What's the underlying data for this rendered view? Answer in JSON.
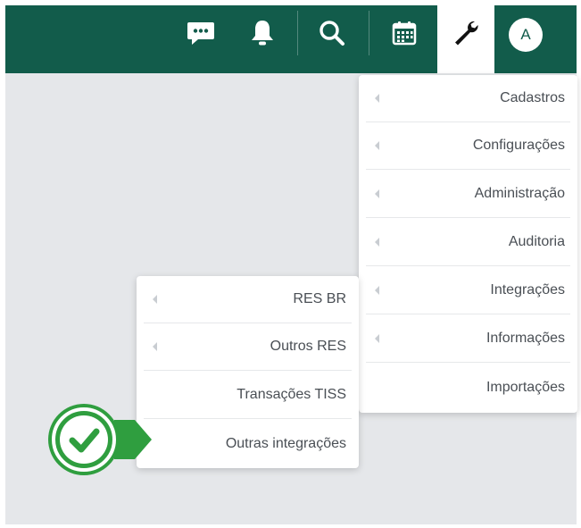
{
  "header": {
    "icons": [
      "chat-icon",
      "bell-icon",
      "search-icon",
      "calendar-icon",
      "wrench-icon"
    ],
    "avatar_letter": "A"
  },
  "main_menu": {
    "items": [
      {
        "label": "Cadastros",
        "has_submenu": true
      },
      {
        "label": "Configurações",
        "has_submenu": true
      },
      {
        "label": "Administração",
        "has_submenu": true
      },
      {
        "label": "Auditoria",
        "has_submenu": true
      },
      {
        "label": "Integrações",
        "has_submenu": true
      },
      {
        "label": "Informações",
        "has_submenu": true
      },
      {
        "label": "Importações",
        "has_submenu": false
      }
    ]
  },
  "sub_menu": {
    "items": [
      {
        "label": "RES BR",
        "has_submenu": true
      },
      {
        "label": "Outros RES",
        "has_submenu": true
      },
      {
        "label": "Transações TISS",
        "has_submenu": false
      },
      {
        "label": "Outras integrações",
        "has_submenu": false
      }
    ]
  },
  "callout": {
    "icon": "checkmark-icon",
    "color": "#2f9e3f"
  },
  "colors": {
    "header_bg": "#125c4b",
    "page_bg": "#e5e7ea",
    "text": "#4a4f55"
  }
}
